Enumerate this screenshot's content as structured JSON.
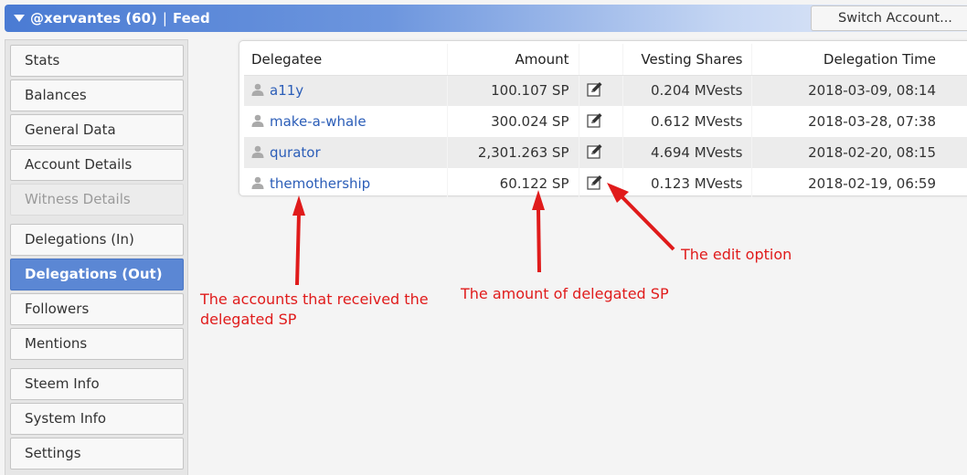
{
  "header": {
    "username": "@xervantes (60)",
    "separator": "|",
    "section": "Feed",
    "switch_account": "Switch Account..."
  },
  "sidebar": {
    "items": [
      {
        "label": "Stats",
        "state": "normal"
      },
      {
        "label": "Balances",
        "state": "normal"
      },
      {
        "label": "General Data",
        "state": "normal"
      },
      {
        "label": "Account Details",
        "state": "normal"
      },
      {
        "label": "Witness Details",
        "state": "disabled"
      },
      {
        "label": "Delegations (In)",
        "state": "normal"
      },
      {
        "label": "Delegations (Out)",
        "state": "active"
      },
      {
        "label": "Followers",
        "state": "normal"
      },
      {
        "label": "Mentions",
        "state": "normal"
      },
      {
        "label": "Steem Info",
        "state": "normal"
      },
      {
        "label": "System Info",
        "state": "normal"
      },
      {
        "label": "Settings",
        "state": "normal"
      }
    ]
  },
  "table": {
    "columns": [
      "Delegatee",
      "Amount",
      "",
      "Vesting Shares",
      "Delegation Time"
    ],
    "rows": [
      {
        "delegatee": "a11y",
        "amount": "100.107 SP",
        "vesting": "0.204 MVests",
        "time": "2018-03-09, 08:14"
      },
      {
        "delegatee": "make-a-whale",
        "amount": "300.024 SP",
        "vesting": "0.612 MVests",
        "time": "2018-03-28, 07:38"
      },
      {
        "delegatee": "qurator",
        "amount": "2,301.263 SP",
        "vesting": "4.694 MVests",
        "time": "2018-02-20, 08:15"
      },
      {
        "delegatee": "themothership",
        "amount": "60.122 SP",
        "vesting": "0.123 MVests",
        "time": "2018-02-19, 06:59"
      }
    ]
  },
  "annotations": {
    "accounts_line1": "The accounts that received the",
    "accounts_line2": "delegated SP",
    "amount": "The amount of delegated SP",
    "edit": "The edit option"
  },
  "colors": {
    "accent": "#5b87d4",
    "link": "#2c5eb8",
    "annotation": "#e01b1b"
  },
  "icons": {
    "user": "user-icon",
    "edit": "edit-icon",
    "dropdown": "triangle-down-icon"
  }
}
